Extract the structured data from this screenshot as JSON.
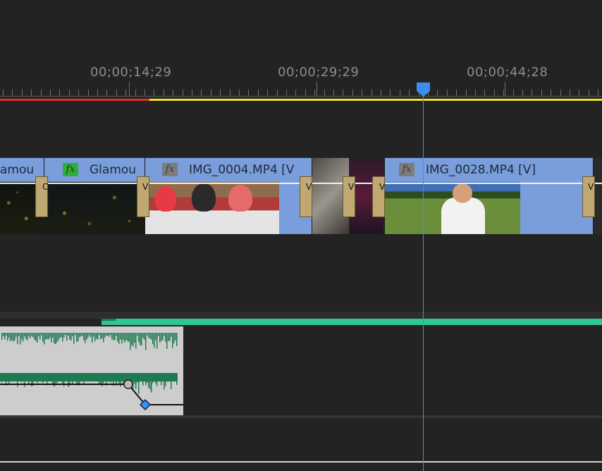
{
  "ruler": {
    "timecodes": [
      "00;00;14;29",
      "00;00;29;29",
      "00;00;44;28"
    ]
  },
  "render_bar": {
    "red_color": "#e0342a",
    "yellow_color": "#efe322"
  },
  "video_track": {
    "clips": [
      {
        "label": "amou",
        "fx_color": "none"
      },
      {
        "label": "Glamou",
        "fx_color": "green"
      },
      {
        "label": "IMG_0004.MP4 [V",
        "fx_color": "gray"
      },
      {
        "label": "IMG_0028.MP4 [V]",
        "fx_color": "gray"
      }
    ],
    "fx_symbol": "fx",
    "transition_markers": [
      "C",
      "V",
      "V",
      "V",
      "V",
      "V"
    ],
    "clip_color": "#7a9ddb"
  },
  "audio_track": {
    "clip_color": "#cdcdcd",
    "waveform_color": "#1f7a52",
    "bar_color": "#2ec791"
  },
  "playhead": {
    "color": "#3b8ef3"
  }
}
